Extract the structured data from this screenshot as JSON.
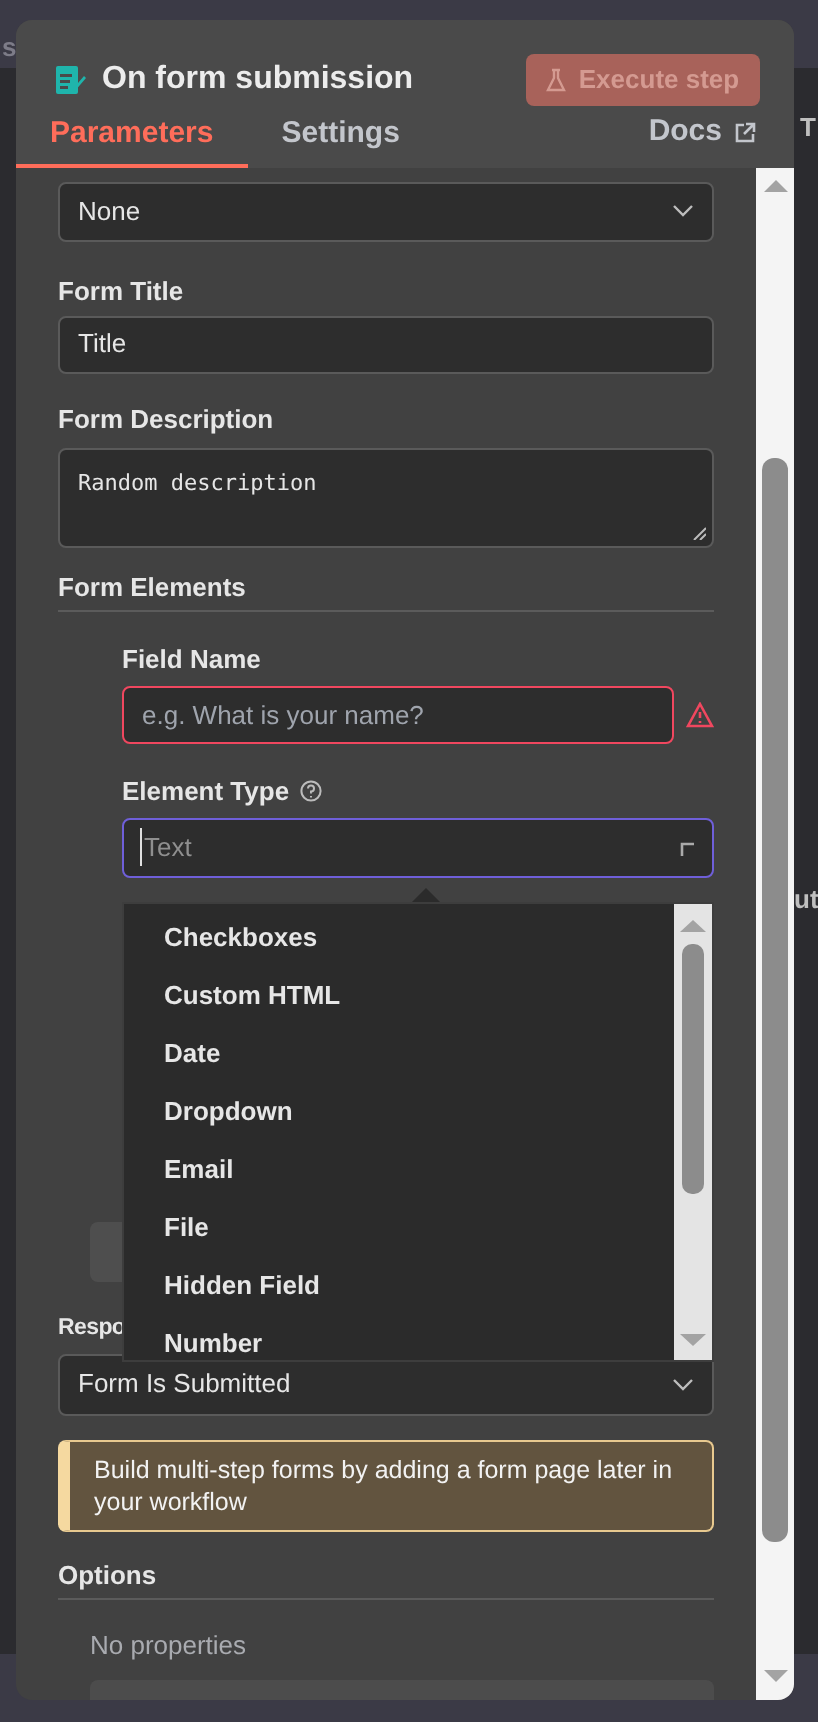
{
  "canvas": {
    "fragments": [
      {
        "text": "s",
        "kind": "left"
      },
      {
        "text": "T",
        "kind": "right"
      },
      {
        "text": "ut",
        "kind": "right"
      }
    ]
  },
  "panel": {
    "title": "On form submission",
    "execute_button": {
      "label": "Execute step",
      "disabled": true
    },
    "tabs": [
      {
        "label": "Parameters",
        "selected": true
      },
      {
        "label": "Settings",
        "selected": false
      }
    ],
    "docs_link": "Docs"
  },
  "top_select": {
    "value": "None"
  },
  "form_title": {
    "label": "Form Title",
    "value": "Title"
  },
  "form_description": {
    "label": "Form Description",
    "value": "Random description"
  },
  "form_elements": {
    "label": "Form Elements",
    "field_name": {
      "label": "Field Name",
      "placeholder": "e.g. What is your name?",
      "error": true
    },
    "element_type": {
      "label": "Element Type",
      "placeholder": "Text",
      "focused": true
    }
  },
  "dropdown": {
    "options": [
      {
        "label": "Checkboxes"
      },
      {
        "label": "Custom HTML"
      },
      {
        "label": "Date"
      },
      {
        "label": "Dropdown"
      },
      {
        "label": "Email"
      },
      {
        "label": "File"
      },
      {
        "label": "Hidden Field"
      },
      {
        "label": "Number"
      }
    ]
  },
  "respond_when": {
    "label": "Respo",
    "value": "Form Is Submitted"
  },
  "notice": "Build multi-step forms by adding a form page later in your workflow",
  "options": {
    "label": "Options",
    "empty_text": "No properties"
  }
}
